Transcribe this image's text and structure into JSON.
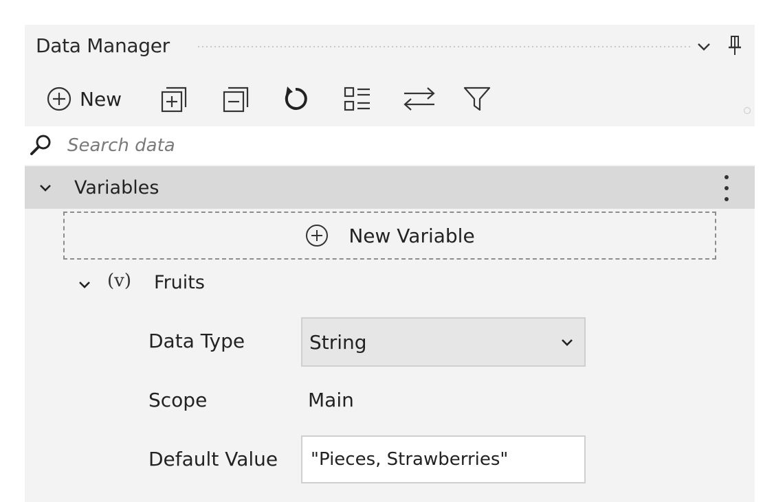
{
  "panel": {
    "title": "Data Manager"
  },
  "toolbar": {
    "new_label": "New",
    "icons": [
      "add-circle-icon",
      "expand-all-icon",
      "collapse-all-icon",
      "refresh-icon",
      "list-view-icon",
      "swap-icon",
      "filter-icon"
    ]
  },
  "search": {
    "placeholder": "Search data"
  },
  "section": {
    "label": "Variables"
  },
  "new_variable": {
    "label": "New Variable"
  },
  "variable": {
    "type_symbol": "(v)",
    "name": "Fruits",
    "properties": {
      "data_type_label": "Data Type",
      "data_type_value": "String",
      "scope_label": "Scope",
      "scope_value": "Main",
      "default_label": "Default Value",
      "default_value": "\"Pieces, Strawberries\""
    }
  },
  "colors": {
    "panel_bg": "#f3f3f3",
    "section_header_bg": "#d9d9d9",
    "input_bg": "#ffffff",
    "select_bg": "#e6e6e6"
  }
}
